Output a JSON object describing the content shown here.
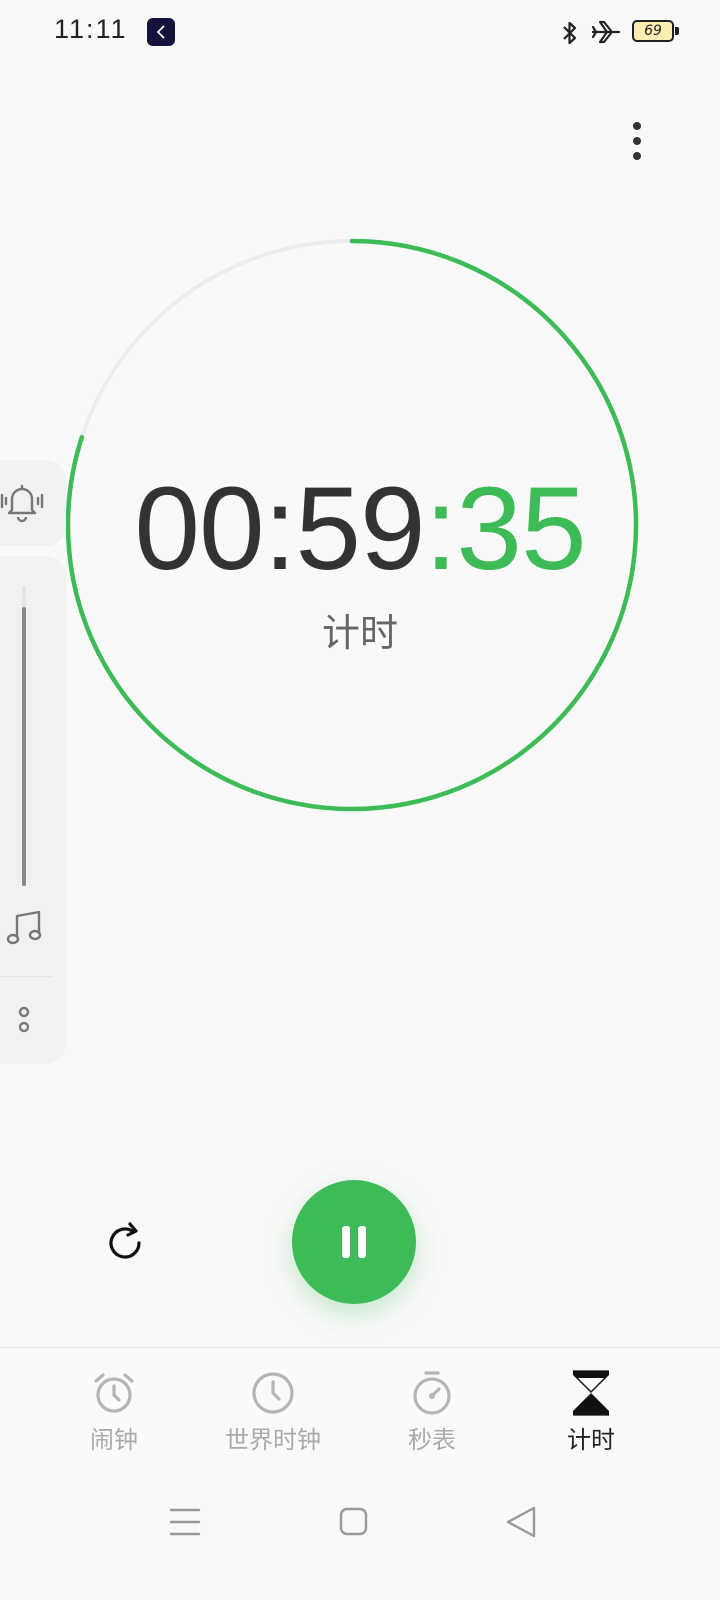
{
  "status_bar": {
    "time": "11:11",
    "battery_level": "69",
    "icons": [
      "app-badge-icon",
      "bluetooth-icon",
      "airplane-mode-icon",
      "battery-icon"
    ]
  },
  "colors": {
    "accent": "#3dbb57",
    "background": "#f9f9f9",
    "text_primary": "#333333",
    "text_inactive": "#aaaaaa"
  },
  "timer": {
    "hours_minutes": "00:59",
    "seconds": ":35",
    "label": "计时",
    "progress_remaining_fraction": 0.8,
    "state": "running"
  },
  "side_panel": {
    "ring_icon": "bell-ringing-icon",
    "volume_fraction": 0.93,
    "ringtone_icon": "music-note-icon",
    "more_icon": "more-vertical-icon"
  },
  "controls": {
    "reset_icon": "reset-icon",
    "pause_icon": "pause-icon"
  },
  "nav": {
    "tabs": [
      {
        "label": "闹钟",
        "icon": "alarm-clock-icon",
        "active": false
      },
      {
        "label": "世界时钟",
        "icon": "world-clock-icon",
        "active": false
      },
      {
        "label": "秒表",
        "icon": "stopwatch-icon",
        "active": false
      },
      {
        "label": "计时",
        "icon": "hourglass-icon",
        "active": true
      }
    ]
  },
  "system_nav": [
    "menu-icon",
    "home-icon",
    "back-icon"
  ]
}
